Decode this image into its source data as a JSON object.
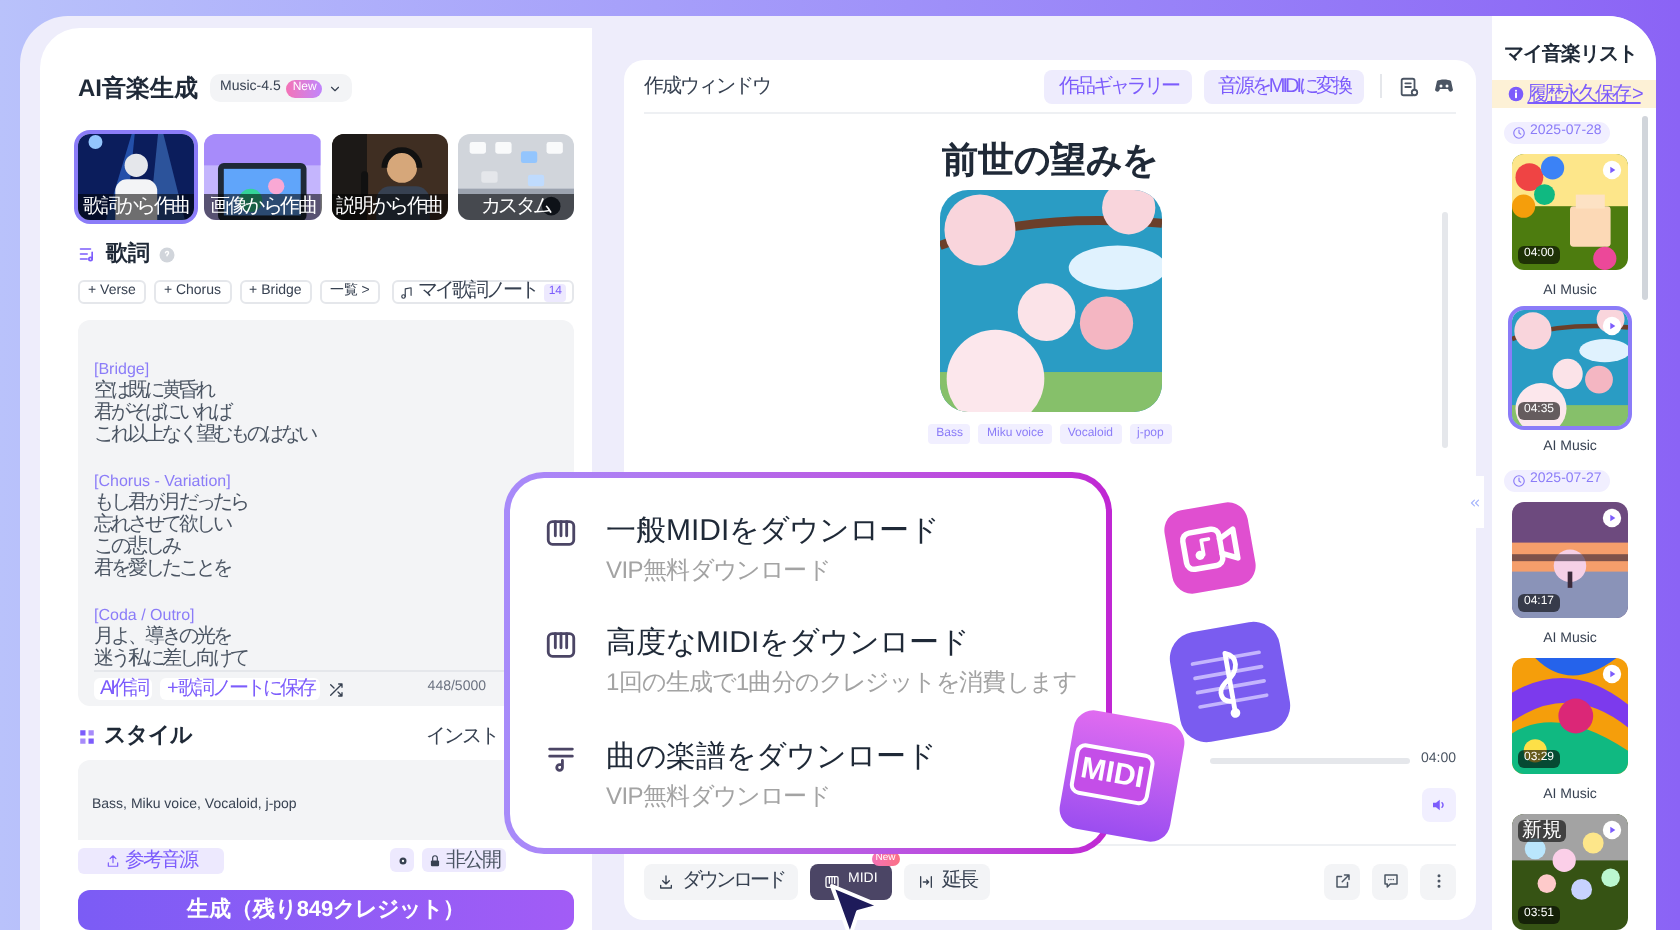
{
  "left_panel": {
    "title": "AI音楽生成",
    "model": {
      "label": "Music-4.5",
      "badge": "New"
    },
    "modes": [
      {
        "label": "歌詞から作曲",
        "selected": true
      },
      {
        "label": "画像から作曲",
        "selected": false
      },
      {
        "label": "説明から作曲",
        "selected": false
      },
      {
        "label": "カスタム",
        "selected": false
      }
    ],
    "lyrics": {
      "title": "歌詞",
      "chips": [
        "+ Verse",
        "+ Chorus",
        "+ Bridge",
        "一覧 >"
      ],
      "notebook": {
        "label": "マイ歌詞ノート",
        "count": "14"
      },
      "stanzas": [
        {
          "tag": "[Bridge]",
          "lines": [
            "空は既に黄昏れ",
            "君がそばにいれば",
            "これ以上なく望むものはない"
          ]
        },
        {
          "tag": "[Chorus - Variation]",
          "lines": [
            "もし君が月だったら",
            "忘れさせて欲しい",
            "この悲しみ",
            "君を愛したことを"
          ]
        },
        {
          "tag": "[Coda / Outro]",
          "lines": [
            "月よ、導きの光を",
            "迷う私に差し向けて"
          ]
        }
      ],
      "actions": [
        "AI作詞",
        "+ 歌詞ノートに保存"
      ],
      "counter": "448/5000"
    },
    "style": {
      "title": "スタイル",
      "instrumental": "インスト",
      "value": "Bass, Miku voice, Vocaloid, j-pop"
    },
    "reference_button": "参考音源",
    "privacy": "非公開",
    "generate_button": "生成（残り849クレジット）"
  },
  "workspace": {
    "title": "作成ウィンドウ",
    "buttons": [
      "作品ギャラリー",
      "音源をMIDIに変換"
    ],
    "song": {
      "title": "前世の望みを",
      "tags": [
        "Bass",
        "Miku voice",
        "Vocaloid",
        "j-pop"
      ],
      "duration": "04:00"
    },
    "toolbar": [
      {
        "kind": "download",
        "label": "ダウンロード",
        "selected": false
      },
      {
        "kind": "midi",
        "label": "MIDI",
        "selected": true,
        "badge": "New"
      },
      {
        "kind": "extend",
        "label": "延長",
        "selected": false
      }
    ]
  },
  "midi_menu": {
    "items": [
      {
        "kind": "piano",
        "title": "一般MIDIをダウンロード",
        "subtitle": "VIP無料ダウンロード"
      },
      {
        "kind": "piano",
        "title": "高度なMIDIをダウンロード",
        "subtitle": "1回の生成で1曲分のクレジットを消費します"
      },
      {
        "kind": "score",
        "title": "曲の楽譜をダウンロード",
        "subtitle": "VIP無料ダウンロード"
      }
    ],
    "sticker": "MIDI"
  },
  "music_list": {
    "title": "マイ音楽リスト",
    "banner": "履歴永久保存 >",
    "groups": [
      {
        "date": "2025-07-28",
        "tracks": [
          {
            "duration": "04:00",
            "title": "AI Music",
            "selected": false
          },
          {
            "duration": "04:35",
            "title": "AI Music",
            "selected": true
          }
        ]
      },
      {
        "date": "2025-07-27",
        "tracks": [
          {
            "duration": "04:17",
            "title": "AI Music",
            "selected": false
          },
          {
            "duration": "03:29",
            "title": "AI Music",
            "selected": false
          },
          {
            "duration": "03:51",
            "badge": "新規",
            "selected": false
          }
        ]
      }
    ]
  }
}
